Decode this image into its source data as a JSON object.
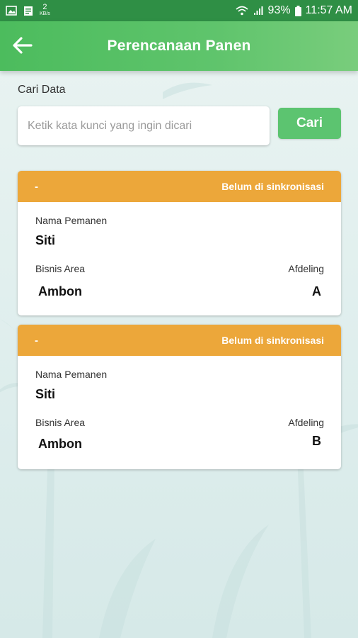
{
  "status_bar": {
    "net_speed_value": "2",
    "net_speed_unit": "KB/s",
    "battery": "93%",
    "time": "11:57 AM"
  },
  "app_bar": {
    "title": "Perencanaan Panen",
    "back_icon": "arrow-left-icon"
  },
  "search": {
    "label": "Cari Data",
    "placeholder": "Ketik kata kunci yang ingin dicari",
    "value": "",
    "button_label": "Cari"
  },
  "cards": [
    {
      "id": "-",
      "sync_status": "Belum di sinkronisasi",
      "harvester_label": "Nama Pemanen",
      "harvester": "Siti",
      "business_area_label": "Bisnis Area",
      "business_area": "Ambon",
      "afdeling_label": "Afdeling",
      "afdeling": "A"
    },
    {
      "id": "-",
      "sync_status": "Belum di sinkronisasi",
      "harvester_label": "Nama Pemanen",
      "harvester": "Siti",
      "business_area_label": "Bisnis Area",
      "business_area": "Ambon",
      "afdeling_label": "Afdeling",
      "afdeling": "B"
    }
  ],
  "colors": {
    "status_bar": "#2f8f45",
    "app_bar": "#4cbc5d",
    "accent_button": "#5cc470",
    "card_header": "#eca73a"
  }
}
